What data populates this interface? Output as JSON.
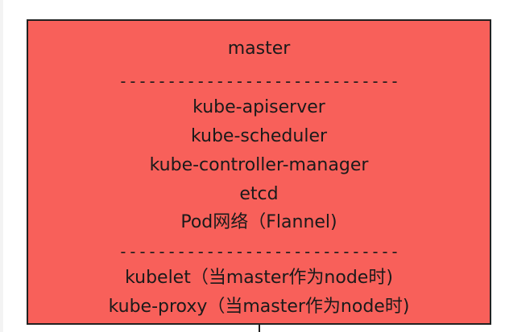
{
  "master": {
    "title": "master",
    "divider": "-----------------------------",
    "components": [
      "kube-apiserver",
      "kube-scheduler",
      "kube-controller-manager",
      "etcd",
      "Pod网络（Flannel)"
    ],
    "node_components": [
      "kubelet（当master作为node时)",
      "kube-proxy（当master作为node时)"
    ]
  },
  "colors": {
    "box_fill": "#f8605a",
    "border": "#222222",
    "text": "#1a1a1a"
  }
}
